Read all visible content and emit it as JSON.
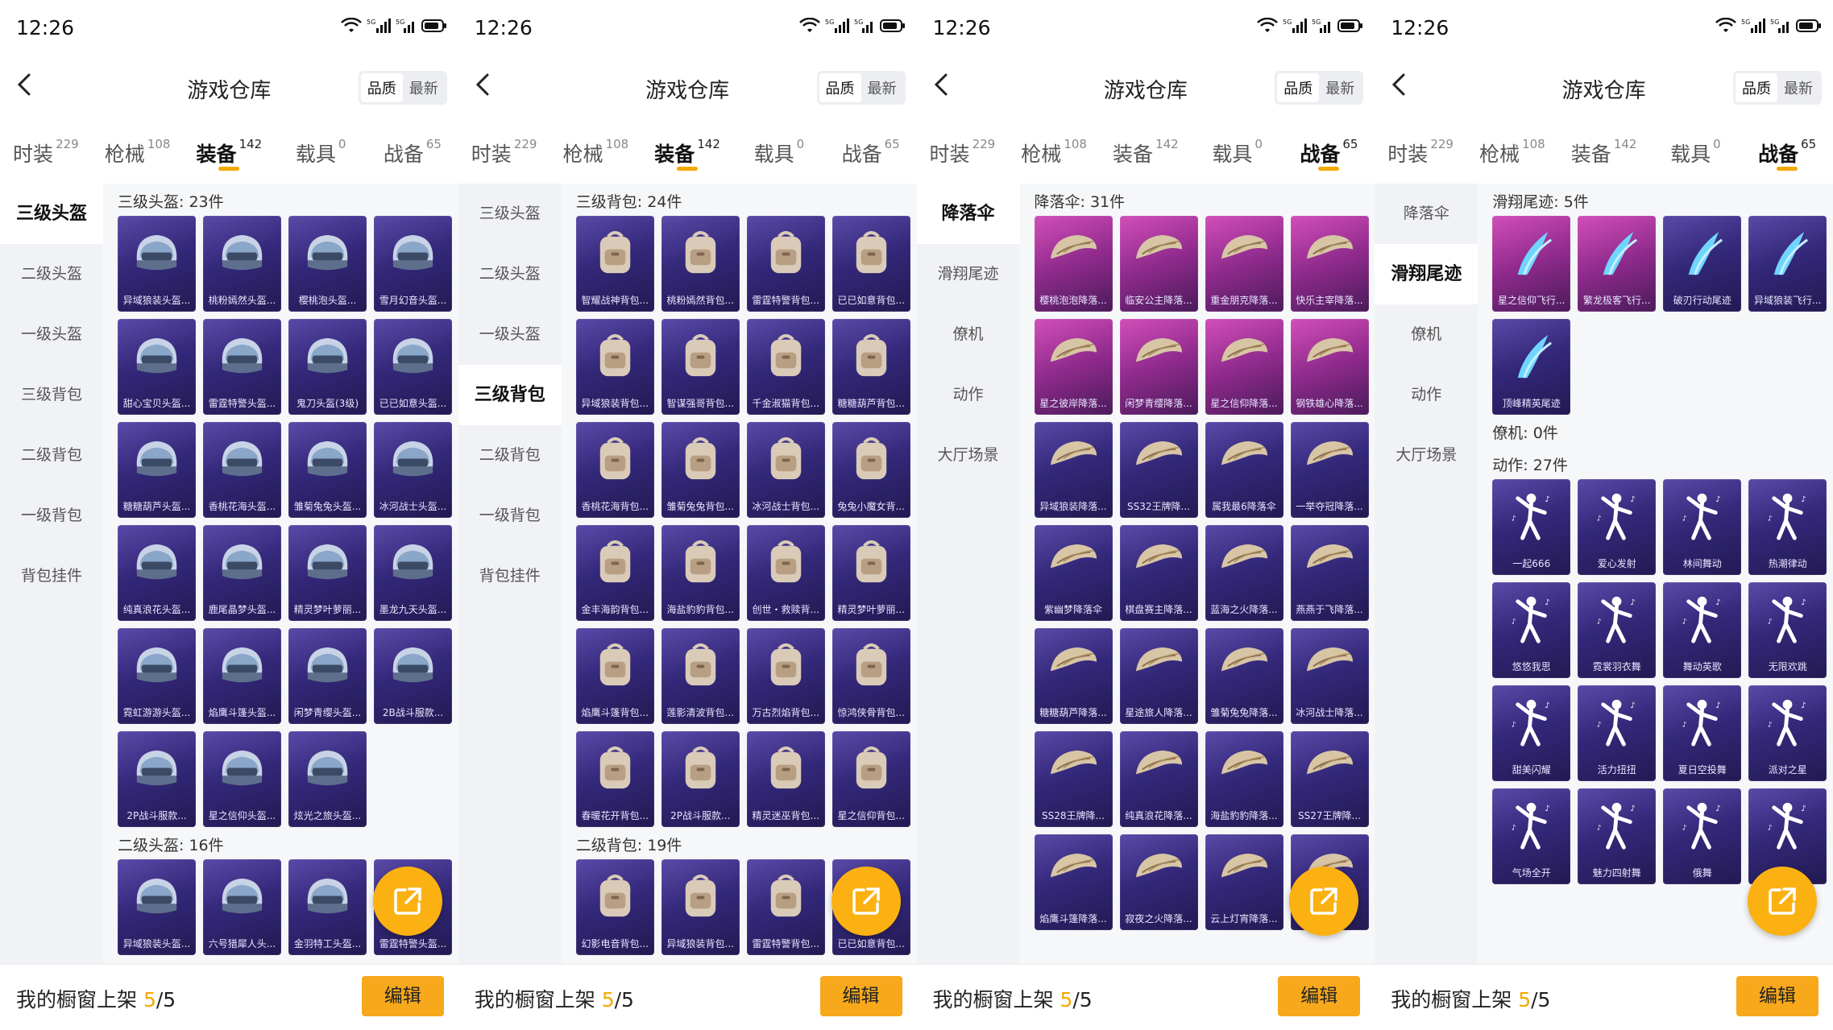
{
  "status": {
    "time": "12:26"
  },
  "header": {
    "title": "游戏仓库",
    "sort_quality": "品质",
    "sort_latest": "最新"
  },
  "tabs": [
    {
      "label": "时装",
      "count": "229"
    },
    {
      "label": "枪械",
      "count": "108"
    },
    {
      "label": "装备",
      "count": "142"
    },
    {
      "label": "载具",
      "count": "0"
    },
    {
      "label": "战备",
      "count": "65"
    }
  ],
  "bottom": {
    "prefix": "我的橱窗上架 ",
    "current": "5",
    "total": "/5",
    "edit": "编辑"
  },
  "colors": {
    "accent": "#f5a800",
    "card_purple": "#34287a",
    "card_pink": "#8f2a8c"
  },
  "panels": [
    {
      "active_tab": 2,
      "nav": [
        "三级头盔",
        "二级头盔",
        "一级头盔",
        "三级背包",
        "二级背包",
        "一级背包",
        "背包挂件"
      ],
      "active_nav": 0,
      "sections": [
        {
          "title": "三级头盔: 23件",
          "items": [
            {
              "name": "异域狼装头盔...",
              "icon": "helmet"
            },
            {
              "name": "桃粉嫣然头盔...",
              "icon": "helmet"
            },
            {
              "name": "樱桃泡头盔...",
              "icon": "helmet"
            },
            {
              "name": "雪月幻音头盔...",
              "icon": "helmet"
            },
            {
              "name": "甜心宝贝头盔...",
              "icon": "helmet"
            },
            {
              "name": "雷霆特警头盔...",
              "icon": "helmet"
            },
            {
              "name": "鬼刀头盔(3级)",
              "icon": "helmet"
            },
            {
              "name": "已已如意头盔...",
              "icon": "helmet"
            },
            {
              "name": "糖糖葫芦头盔...",
              "icon": "helmet"
            },
            {
              "name": "香桃花海头盔...",
              "icon": "helmet"
            },
            {
              "name": "雏菊兔兔头盔...",
              "icon": "helmet"
            },
            {
              "name": "冰河战士头盔...",
              "icon": "helmet"
            },
            {
              "name": "纯真浪花头盔...",
              "icon": "helmet"
            },
            {
              "name": "鹿尾晶梦头盔...",
              "icon": "helmet"
            },
            {
              "name": "精灵梦叶萝丽...",
              "icon": "helmet"
            },
            {
              "name": "墨龙九天头盔...",
              "icon": "helmet"
            },
            {
              "name": "霓虹游游头盔...",
              "icon": "helmet"
            },
            {
              "name": "焰鹰斗篷头盔...",
              "icon": "helmet"
            },
            {
              "name": "闲梦青缨头盔...",
              "icon": "helmet"
            },
            {
              "name": "2B战斗服款...",
              "icon": "helmet"
            },
            {
              "name": "2P战斗服款...",
              "icon": "helmet"
            },
            {
              "name": "星之信仰头盔...",
              "icon": "helmet"
            },
            {
              "name": "炫光之旅头盔...",
              "icon": "helmet"
            }
          ]
        },
        {
          "title": "二级头盔: 16件",
          "items": [
            {
              "name": "异域狼装头盔...",
              "icon": "helmet"
            },
            {
              "name": "六号猎犀人头...",
              "icon": "helmet"
            },
            {
              "name": "金羽特工头盔...",
              "icon": "helmet"
            },
            {
              "name": "雷霆特警头盔...",
              "icon": "helmet"
            }
          ]
        }
      ]
    },
    {
      "active_tab": 2,
      "nav": [
        "三级头盔",
        "二级头盔",
        "一级头盔",
        "三级背包",
        "二级背包",
        "一级背包",
        "背包挂件"
      ],
      "active_nav": 3,
      "sections": [
        {
          "title": "三级背包: 24件",
          "items": [
            {
              "name": "智耀战神背包...",
              "icon": "backpack"
            },
            {
              "name": "桃粉嫣然背包...",
              "icon": "backpack"
            },
            {
              "name": "雷霆特警背包...",
              "icon": "backpack"
            },
            {
              "name": "已已如意背包...",
              "icon": "backpack"
            },
            {
              "name": "异域狼装背包...",
              "icon": "backpack"
            },
            {
              "name": "智谋强哥背包...",
              "icon": "backpack"
            },
            {
              "name": "千金淑猫背包...",
              "icon": "backpack"
            },
            {
              "name": "糖糖葫芦背包...",
              "icon": "backpack"
            },
            {
              "name": "香桃花海背包...",
              "icon": "backpack"
            },
            {
              "name": "雏菊兔兔背包...",
              "icon": "backpack"
            },
            {
              "name": "冰河战士背包...",
              "icon": "backpack"
            },
            {
              "name": "兔兔小魔女背...",
              "icon": "backpack"
            },
            {
              "name": "金丰海韵背包...",
              "icon": "backpack"
            },
            {
              "name": "海盐豹豹背包...",
              "icon": "backpack"
            },
            {
              "name": "创世・救赎背...",
              "icon": "backpack"
            },
            {
              "name": "精灵梦叶萝丽...",
              "icon": "backpack"
            },
            {
              "name": "焰鹰斗篷背包...",
              "icon": "backpack"
            },
            {
              "name": "莲影清波背包...",
              "icon": "backpack"
            },
            {
              "name": "万古烈焰背包...",
              "icon": "backpack"
            },
            {
              "name": "惊鸿侠骨背包...",
              "icon": "backpack"
            },
            {
              "name": "春暖花开背包...",
              "icon": "backpack"
            },
            {
              "name": "2P战斗服款...",
              "icon": "backpack"
            },
            {
              "name": "精灵迷巫背包...",
              "icon": "backpack"
            },
            {
              "name": "星之信仰背包...",
              "icon": "backpack"
            }
          ]
        },
        {
          "title": "二级背包: 19件",
          "items": [
            {
              "name": "幻影电音背包...",
              "icon": "backpack"
            },
            {
              "name": "异域狼装背包...",
              "icon": "backpack"
            },
            {
              "name": "雷霆特警背包...",
              "icon": "backpack"
            },
            {
              "name": "已已如意背包...",
              "icon": "backpack"
            }
          ]
        }
      ]
    },
    {
      "active_tab": 4,
      "nav": [
        "降落伞",
        "滑翔尾迹",
        "僚机",
        "动作",
        "大厅场景"
      ],
      "active_nav": 0,
      "sections": [
        {
          "title": "降落伞: 31件",
          "items": [
            {
              "name": "樱桃泡泡降落...",
              "icon": "parachute",
              "pink": true
            },
            {
              "name": "临安公主降落...",
              "icon": "parachute",
              "pink": true
            },
            {
              "name": "重金朋克降落...",
              "icon": "parachute",
              "pink": true
            },
            {
              "name": "快乐主宰降落...",
              "icon": "parachute",
              "pink": true
            },
            {
              "name": "星之彼岸降落...",
              "icon": "parachute",
              "pink": true
            },
            {
              "name": "闲梦青缨降落...",
              "icon": "parachute",
              "pink": true
            },
            {
              "name": "星之信仰降落...",
              "icon": "parachute",
              "pink": true
            },
            {
              "name": "钢铁雄心降落...",
              "icon": "parachute",
              "pink": true
            },
            {
              "name": "异域狼装降落...",
              "icon": "parachute"
            },
            {
              "name": "SS32王牌降...",
              "icon": "parachute"
            },
            {
              "name": "属我最6降落伞",
              "icon": "parachute"
            },
            {
              "name": "一举夺冠降落...",
              "icon": "parachute"
            },
            {
              "name": "紫幽梦降落伞",
              "icon": "parachute"
            },
            {
              "name": "棋盘赛主降落...",
              "icon": "parachute"
            },
            {
              "name": "蓝海之火降落...",
              "icon": "parachute"
            },
            {
              "name": "燕燕于飞降落...",
              "icon": "parachute"
            },
            {
              "name": "糖糖葫芦降落...",
              "icon": "parachute"
            },
            {
              "name": "星途旅人降落...",
              "icon": "parachute"
            },
            {
              "name": "雏菊兔兔降落...",
              "icon": "parachute"
            },
            {
              "name": "冰河战士降落...",
              "icon": "parachute"
            },
            {
              "name": "SS28王牌降...",
              "icon": "parachute"
            },
            {
              "name": "纯真浪花降落...",
              "icon": "parachute"
            },
            {
              "name": "海盐豹豹降落...",
              "icon": "parachute"
            },
            {
              "name": "SS27王牌降...",
              "icon": "parachute"
            },
            {
              "name": "焰鹰斗篷降落...",
              "icon": "parachute"
            },
            {
              "name": "寂夜之火降落...",
              "icon": "parachute"
            },
            {
              "name": "云上灯宵降落...",
              "icon": "parachute"
            },
            {
              "name": "",
              "icon": "parachute"
            }
          ]
        }
      ]
    },
    {
      "active_tab": 4,
      "nav": [
        "降落伞",
        "滑翔尾迹",
        "僚机",
        "动作",
        "大厅场景"
      ],
      "active_nav": 1,
      "sections": [
        {
          "title": "滑翔尾迹: 5件",
          "items": [
            {
              "name": "星之信仰飞行...",
              "icon": "trail",
              "pink": true
            },
            {
              "name": "繁龙极客飞行...",
              "icon": "trail",
              "pink": true
            },
            {
              "name": "破刃行动尾迹",
              "icon": "trail"
            },
            {
              "name": "异域狼装飞行...",
              "icon": "trail"
            },
            {
              "name": "顶峰精英尾迹",
              "icon": "trail"
            }
          ]
        },
        {
          "title": "僚机: 0件",
          "items": []
        },
        {
          "title": "动作: 27件",
          "items": [
            {
              "name": "一起666",
              "icon": "dance"
            },
            {
              "name": "爱心发射",
              "icon": "dance"
            },
            {
              "name": "林间舞动",
              "icon": "dance"
            },
            {
              "name": "热潮律动",
              "icon": "dance"
            },
            {
              "name": "悠悠我思",
              "icon": "dance"
            },
            {
              "name": "霓裳羽衣舞",
              "icon": "dance"
            },
            {
              "name": "舞动英歌",
              "icon": "dance"
            },
            {
              "name": "无限欢跳",
              "icon": "dance"
            },
            {
              "name": "甜美闪耀",
              "icon": "dance"
            },
            {
              "name": "活力扭扭",
              "icon": "dance"
            },
            {
              "name": "夏日空投舞",
              "icon": "dance"
            },
            {
              "name": "派对之星",
              "icon": "dance"
            },
            {
              "name": "气场全开",
              "icon": "dance"
            },
            {
              "name": "魅力四射舞",
              "icon": "dance"
            },
            {
              "name": "俄舞",
              "icon": "dance"
            },
            {
              "name": "",
              "icon": "dance"
            }
          ]
        }
      ]
    }
  ]
}
